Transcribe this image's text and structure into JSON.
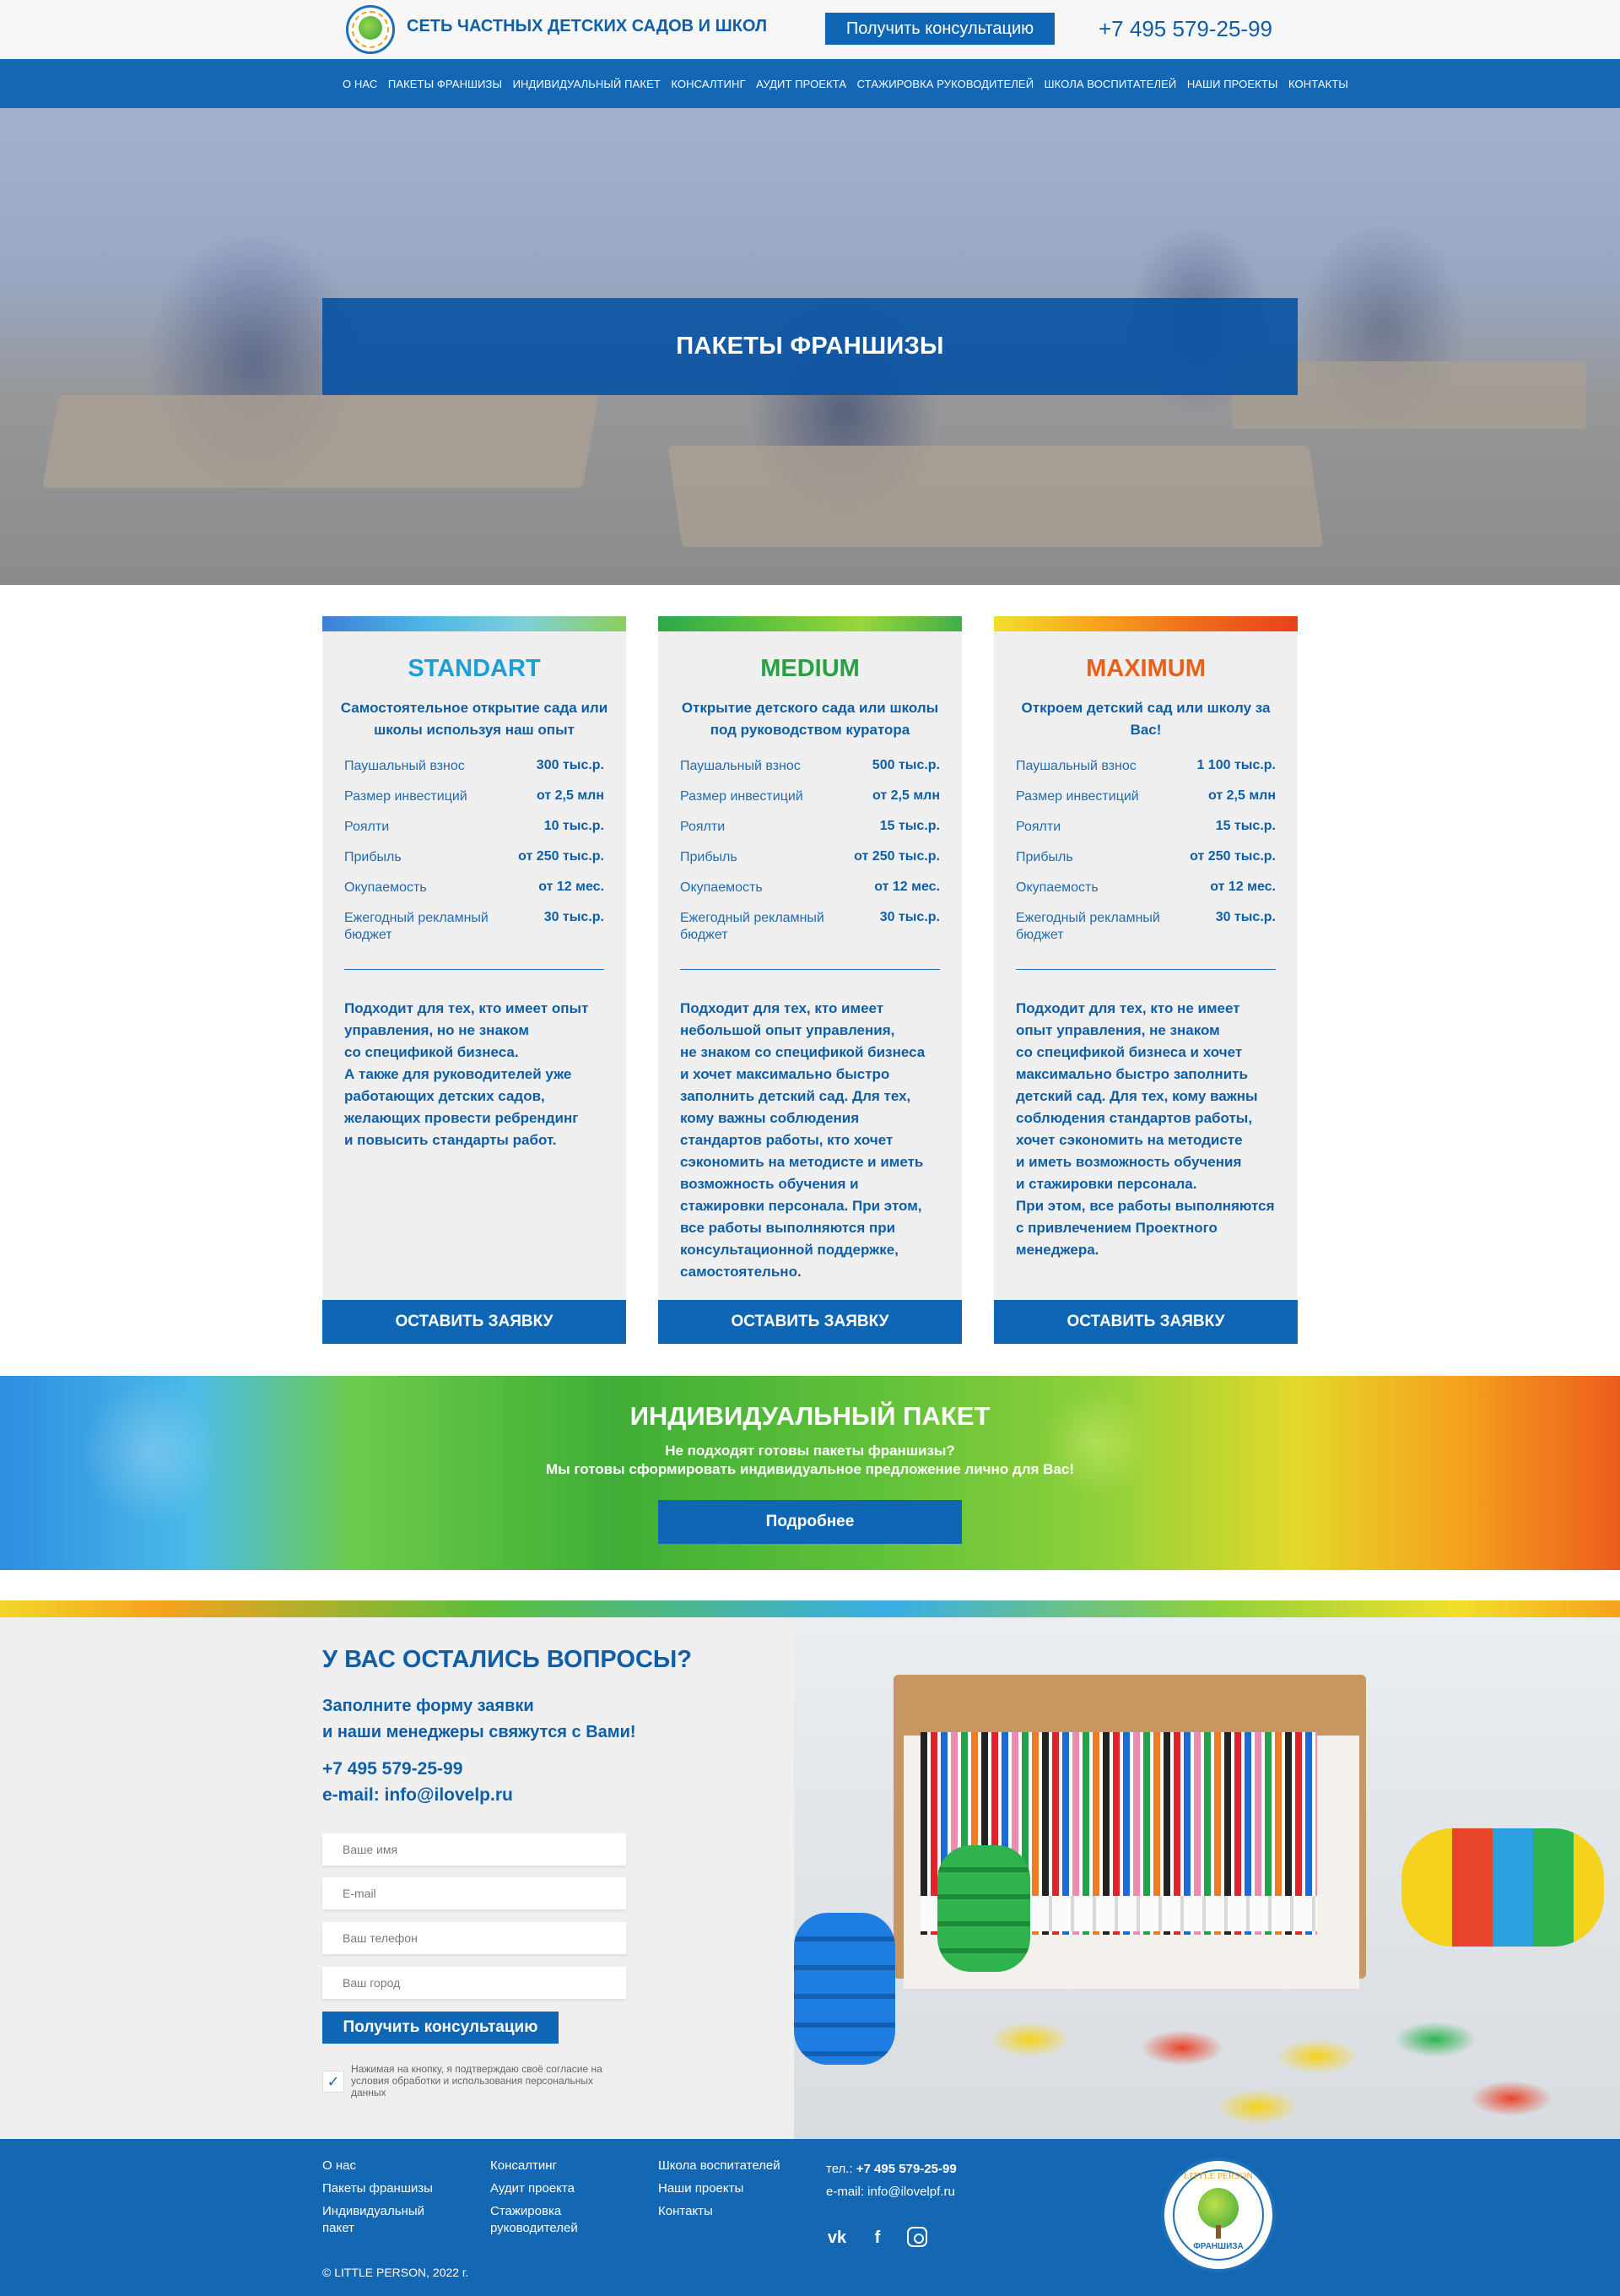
{
  "header": {
    "logo_icon": "little-person-logo",
    "site_title": "СЕТЬ ЧАСТНЫХ ДЕТСКИХ САДОВ И ШКОЛ",
    "consult_button": "Получить консультацию",
    "phone": "+7 495 579-25-99"
  },
  "nav": {
    "items": [
      {
        "label": "О НАС"
      },
      {
        "label": "ПАКЕТЫ ФРАНШИЗЫ"
      },
      {
        "label": "ИНДИВИДУАЛЬНЫЙ ПАКЕТ"
      },
      {
        "label": "КОНСАЛТИНГ"
      },
      {
        "label": "АУДИТ ПРОЕКТА"
      },
      {
        "label": "СТАЖИРОВКА РУКОВОДИТЕЛЕЙ"
      },
      {
        "label": "ШКОЛА ВОСПИТАТЕЛЕЙ"
      },
      {
        "label": "НАШИ ПРОЕКТЫ"
      },
      {
        "label": "КОНТАКТЫ"
      }
    ]
  },
  "hero": {
    "title": "ПАКЕТЫ ФРАНШИЗЫ"
  },
  "packages": [
    {
      "name": "STANDART",
      "accent": "#1a9fd9",
      "subtitle": "Самостоятельное открытие сада или школы используя наш опыт",
      "params": [
        {
          "label": "Паушальный взнос",
          "value": "300 тыс.р."
        },
        {
          "label": "Размер инвестиций",
          "value": "от 2,5 млн"
        },
        {
          "label": "Роялти",
          "value": "10 тыс.р."
        },
        {
          "label": "Прибыль",
          "value": "от 250 тыс.р."
        },
        {
          "label": "Окупаемость",
          "value": "от 12 мес."
        },
        {
          "label": "Ежегодный рекламный бюджет",
          "value": "30 тыс.р."
        }
      ],
      "description": "Подходит для тех, кто имеет опыт\nуправления, но не знаком\nсо спецификой бизнеса.\nА также для руководителей уже\nработающих детских садов,\nжелающих провести ребрендинг\nи повысить стандарты работ.",
      "button": "ОСТАВИТЬ ЗАЯВКУ"
    },
    {
      "name": "MEDIUM",
      "accent": "#28a043",
      "subtitle": "Открытие детского сада или школы под руководством куратора",
      "params": [
        {
          "label": "Паушальный взнос",
          "value": "500 тыс.р."
        },
        {
          "label": "Размер инвестиций",
          "value": "от 2,5 млн"
        },
        {
          "label": "Роялти",
          "value": "15 тыс.р."
        },
        {
          "label": "Прибыль",
          "value": "от 250 тыс.р."
        },
        {
          "label": "Окупаемость",
          "value": "от 12 мес."
        },
        {
          "label": "Ежегодный рекламный бюджет",
          "value": "30 тыс.р."
        }
      ],
      "description": "Подходит для тех, кто имеет\nнебольшой опыт управления,\nне знаком со спецификой бизнеса\nи хочет максимально быстро\nзаполнить детский сад. Для тех,\nкому важны соблюдения\nстандартов работы, кто хочет\nсэкономить на методисте и иметь\nвозможность обучения и\nстажировки персонала. При этом,\nвсе работы выполняются при\nконсультационной поддержке,\nсамостоятельно.",
      "button": "ОСТАВИТЬ ЗАЯВКУ"
    },
    {
      "name": "MAXIMUM",
      "accent": "#e8601c",
      "subtitle": "Откроем детский сад или школу за Вас!",
      "params": [
        {
          "label": "Паушальный взнос",
          "value": "1 100 тыс.р."
        },
        {
          "label": "Размер инвестиций",
          "value": "от 2,5 млн"
        },
        {
          "label": "Роялти",
          "value": "15 тыс.р."
        },
        {
          "label": "Прибыль",
          "value": "от 250 тыс.р."
        },
        {
          "label": "Окупаемость",
          "value": "от 12 мес."
        },
        {
          "label": "Ежегодный рекламный бюджет",
          "value": "30 тыс.р."
        }
      ],
      "description": "Подходит для тех, кто не имеет\nопыт управления, не знаком\nсо спецификой бизнеса и хочет\nмаксимально быстро заполнить\nдетский сад. Для тех, кому важны\nсоблюдения стандартов работы,\nхочет сэкономить на методисте\nи иметь возможность обучения\nи стажировки персонала.\nПри этом, все работы выполняются\nс привлечением Проектного\nменеджера.",
      "button": "ОСТАВИТЬ ЗАЯВКУ"
    }
  ],
  "individual": {
    "title": "ИНДИВИДУАЛЬНЫЙ ПАКЕТ",
    "line1": "Не подходят готовы пакеты франшизы?",
    "line2": "Мы готовы сформировать индивидуальное предложение лично для Вас!",
    "button": "Подробнее"
  },
  "questions": {
    "title": "У ВАС ОСТАЛИСЬ ВОПРОСЫ?",
    "sub1": "Заполните форму заявки",
    "sub2": "и наши менеджеры свяжутся с Вами!",
    "phone": "+7 495 579-25-99",
    "email": "e-mail: info@ilovelp.ru",
    "name_placeholder": "Ваше имя",
    "email_placeholder": "E-mail",
    "phone_placeholder": "Ваш телефон",
    "city_placeholder": "Ваш город",
    "button": "Получить консультацию",
    "consent_checked": true,
    "consent_text": "Нажимая на кнопку, я подтверждаю своё согласие на условия обработки и использования персональных данных"
  },
  "footer": {
    "col1": [
      "О нас",
      "Пакеты франшизы",
      "Индивидуальный пакет"
    ],
    "col2": [
      "Консалтинг",
      "Аудит проекта",
      "Стажировка руководителей"
    ],
    "col3": [
      "Школа воспитателей",
      "Наши проекты",
      "Контакты"
    ],
    "phone_label": "тел.:",
    "phone": "+7 495 579-25-99",
    "email": "e-mail: info@ilovelpf.ru",
    "social_icons": [
      "vk-icon",
      "facebook-icon",
      "instagram-icon"
    ],
    "copyright": "© LITTLE PERSON, 2022 г.",
    "logo_top": "LITTLE PERSON",
    "logo_bottom": "ФРАНШИЗА"
  }
}
